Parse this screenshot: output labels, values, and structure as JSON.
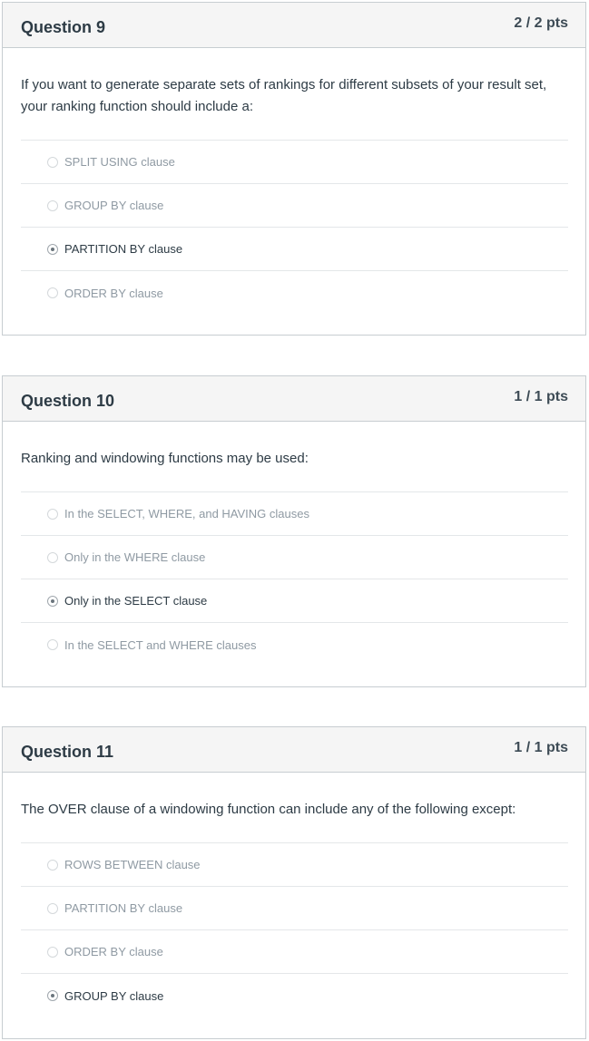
{
  "questions": [
    {
      "title": "Question 9",
      "points": "2 / 2 pts",
      "text": "If you want to generate separate sets of rankings for different subsets of your result set, your ranking function should include a:",
      "answers": [
        {
          "label": "SPLIT USING clause",
          "selected": false
        },
        {
          "label": "GROUP BY clause",
          "selected": false
        },
        {
          "label": "PARTITION BY clause",
          "selected": true
        },
        {
          "label": "ORDER BY clause",
          "selected": false
        }
      ]
    },
    {
      "title": "Question 10",
      "points": "1 / 1 pts",
      "text": "Ranking and windowing functions may be used:",
      "answers": [
        {
          "label": "In the SELECT, WHERE, and HAVING clauses",
          "selected": false
        },
        {
          "label": "Only in the WHERE clause",
          "selected": false
        },
        {
          "label": "Only in the SELECT clause",
          "selected": true
        },
        {
          "label": "In the SELECT and WHERE clauses",
          "selected": false
        }
      ]
    },
    {
      "title": "Question 11",
      "points": "1 / 1 pts",
      "text": "The OVER clause of a windowing function can include any of the following except:",
      "answers": [
        {
          "label": "ROWS BETWEEN clause",
          "selected": false
        },
        {
          "label": "PARTITION BY clause",
          "selected": false
        },
        {
          "label": "ORDER BY clause",
          "selected": false
        },
        {
          "label": "GROUP BY clause",
          "selected": true
        }
      ]
    }
  ]
}
